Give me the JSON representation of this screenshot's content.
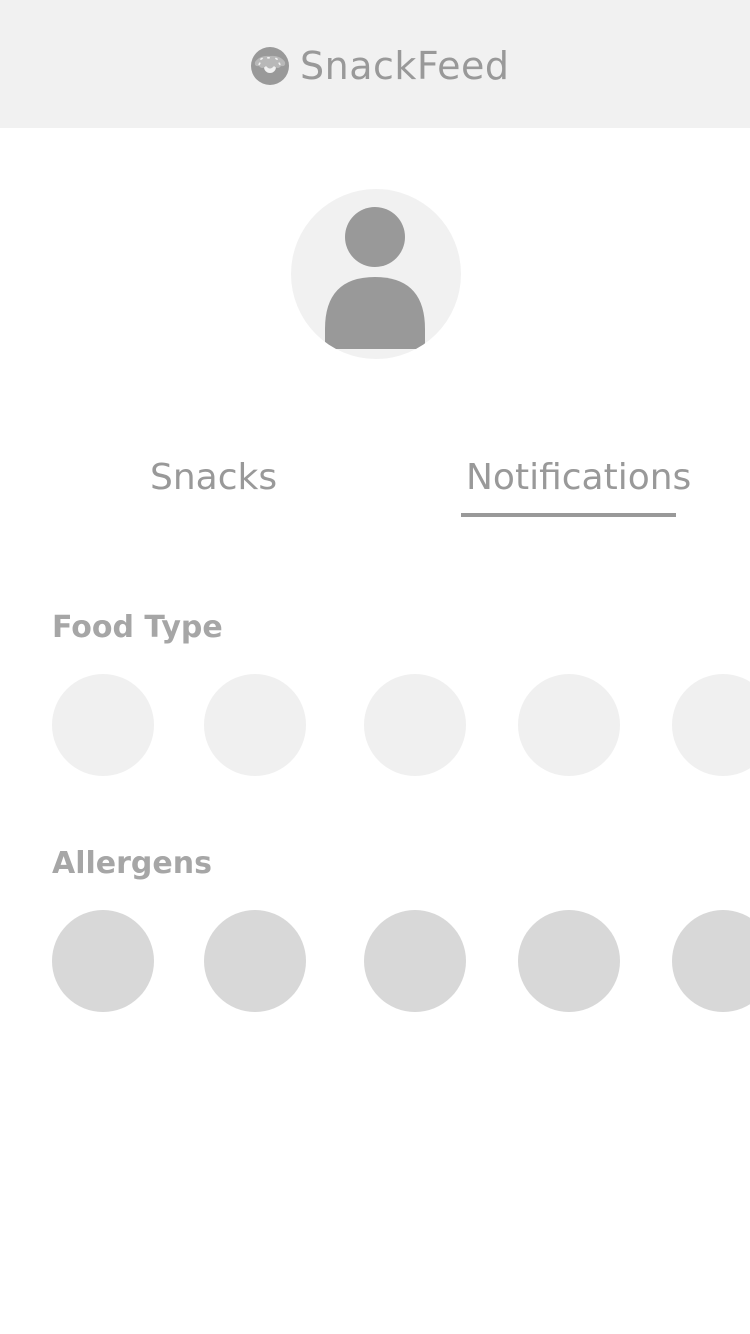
{
  "header": {
    "brand_name": "SnackFeed",
    "logo_icon": "donut-icon",
    "background": "#f1f1f1",
    "text_color": "#999999"
  },
  "profile": {
    "avatar_icon": "user-silhouette-icon"
  },
  "tabs": [
    {
      "label": "Snacks",
      "active": false
    },
    {
      "label": "Notifications",
      "active": true
    }
  ],
  "sections": {
    "food_type": {
      "label": "Food Type",
      "chip_color": "#f0f0f0"
    },
    "allergens": {
      "label": "Allergens",
      "chip_color": "#d8d8d8"
    }
  }
}
